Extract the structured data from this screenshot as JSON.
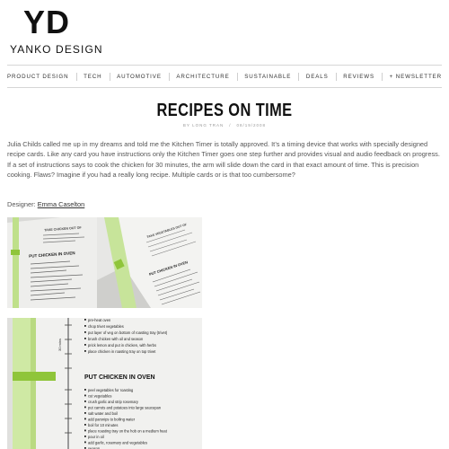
{
  "header": {
    "logo_mark": "YD",
    "logo_text": "YANKO DESIGN"
  },
  "nav": {
    "items": [
      {
        "label": "PRODUCT DESIGN"
      },
      {
        "label": "TECH"
      },
      {
        "label": "AUTOMOTIVE"
      },
      {
        "label": "ARCHITECTURE"
      },
      {
        "label": "SUSTAINABLE"
      },
      {
        "label": "DEALS"
      },
      {
        "label": "REVIEWS"
      },
      {
        "label": "+ NEWSLETTER"
      }
    ]
  },
  "article": {
    "title": "RECIPES ON TIME",
    "author": "BY LONG TRAN",
    "separator": "/",
    "date": "08/19/2008",
    "body": "Julia Childs called me up in my dreams and told me the Kitchen Timer is totally approved. It’s a timing device that works with specially designed recipe cards. Like any card you have instructions only the Kitchen Timer goes one step further and provides visual and audio feedback on progress. If a set of instructions says to cook the chicken for 30 minutes, the arm will slide down the card in that exact amount of time. This is precision cooking. Flaws? Imagine if you had a really long recipe. Multiple cards or is that too cumbersome?",
    "designer_label": "Designer:",
    "designer_name": "Emma Caselton"
  },
  "photos": {
    "photo1": {
      "card_heading": "TAKE CHICKEN OUT OF",
      "step_heading": "PUT CHICKEN IN OVEN"
    },
    "photo2": {
      "card_heading": "TAKE VEGETABLES OUT OF",
      "step_heading": "PUT CHICKEN IN OVEN"
    },
    "photo3": {
      "time_label": "30 mins",
      "lines_top": [
        "pre-heat oven",
        "chop trivet vegetables",
        "put layer of veg on bottom of roasting tray (trivet)",
        "brush chicken with oil and season",
        "prick lemon and put in chicken, with herbs",
        "place chicken in roasting tray on top trivet"
      ],
      "step_heading": "PUT CHICKEN IN OVEN",
      "lines_bottom": [
        "peel vegetables for roasting",
        "cut vegetables",
        "crush garlic and strip rosemary",
        "put carrots and potatoes into large saucepan",
        "salt water and boil",
        "add parsnips to boiling water",
        "boil for 10 minutes",
        "place roasting tray on the hob on a medium heat",
        "pour in oil",
        "add garlic, rosemary and vegetables",
        "season"
      ]
    }
  }
}
